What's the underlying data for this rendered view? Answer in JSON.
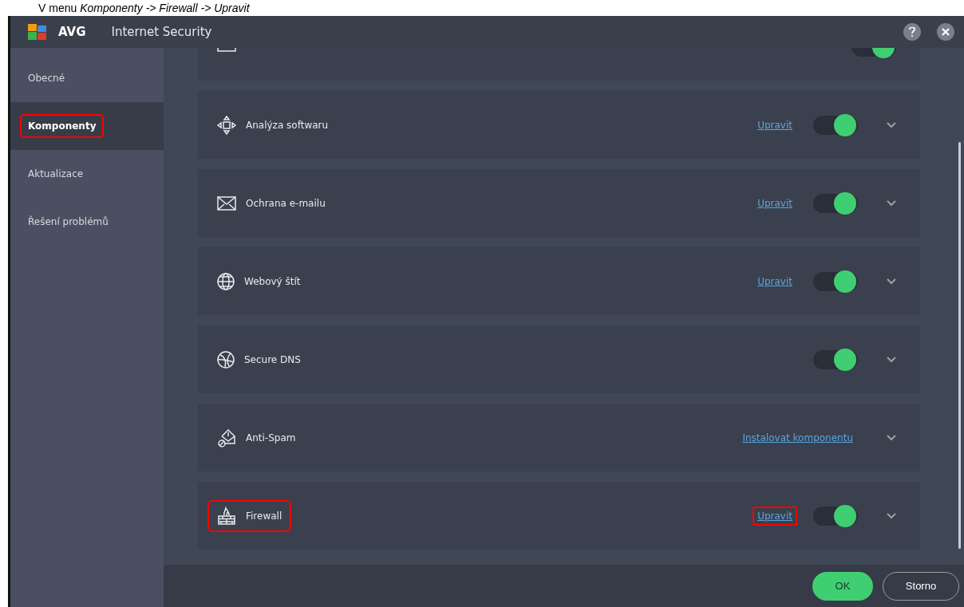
{
  "caption": "V menu *Komponenty -> Firewall -> Upravit*",
  "window": {
    "brand": "AVG",
    "title": "Internet Security"
  },
  "sidebar": {
    "items": [
      {
        "label": "Obecné",
        "selected": false,
        "highlighted": false
      },
      {
        "label": "Komponenty",
        "selected": true,
        "highlighted": true
      },
      {
        "label": "Aktualizace",
        "selected": false,
        "highlighted": false
      },
      {
        "label": "Řešení problémů",
        "selected": false,
        "highlighted": false
      }
    ]
  },
  "partial_row": {
    "kind": "frame",
    "toggle_on": true
  },
  "components": [
    {
      "kind": "software",
      "label": "Analýza softwaru",
      "link": {
        "text": "Upravit",
        "highlighted": false
      },
      "toggle_on": true,
      "highlighted": false
    },
    {
      "kind": "email",
      "label": "Ochrana e-mailu",
      "link": {
        "text": "Upravit",
        "highlighted": false
      },
      "toggle_on": true,
      "highlighted": false
    },
    {
      "kind": "web",
      "label": "Webový štít",
      "link": {
        "text": "Upravit",
        "highlighted": false
      },
      "toggle_on": true,
      "highlighted": false
    },
    {
      "kind": "dns",
      "label": "Secure DNS",
      "toggle_on": true,
      "highlighted": false
    },
    {
      "kind": "spam",
      "label": "Anti-Spam",
      "link": {
        "text": "Instalovat komponentu",
        "highlighted": false
      },
      "highlighted": false
    },
    {
      "kind": "firewall",
      "label": "Firewall",
      "link": {
        "text": "Upravit",
        "highlighted": true
      },
      "toggle_on": true,
      "highlighted": true
    }
  ],
  "buttons": {
    "ok": "OK",
    "cancel": "Storno"
  }
}
